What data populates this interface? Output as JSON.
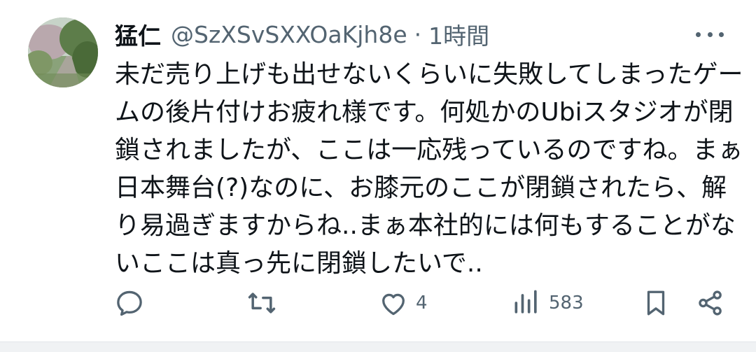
{
  "author": {
    "display_name": "猛仁",
    "handle": "@SzXSvSXXOaKjh8e",
    "separator": "·",
    "timestamp": "1時間"
  },
  "more_menu": {
    "icon": "more-dots-icon"
  },
  "post": {
    "lines": [
      "未だ売り上げも出せないくらいに失敗してしまったゲー",
      "ムの後片付けお疲れ様です。何処かのUbiスタジオが閉",
      "鎖されましたが、ここは一応残っているのですね。まぁ",
      "日本舞台(?)なのに、お膝元のここが閉鎖されたら、解",
      "り易過ぎますからね..まぁ本社的には何もすることがな",
      "いここは真っ先に閉鎖したいで.."
    ]
  },
  "actions": {
    "reply": {
      "icon": "reply-icon",
      "count": ""
    },
    "repost": {
      "icon": "repost-icon",
      "count": ""
    },
    "like": {
      "icon": "heart-icon",
      "count": "4"
    },
    "views": {
      "icon": "views-icon",
      "count": "583"
    },
    "bookmark": {
      "icon": "bookmark-icon"
    },
    "share": {
      "icon": "share-icon"
    }
  },
  "colors": {
    "text_primary": "#0f1419",
    "text_secondary": "#536471",
    "background": "#ffffff"
  }
}
